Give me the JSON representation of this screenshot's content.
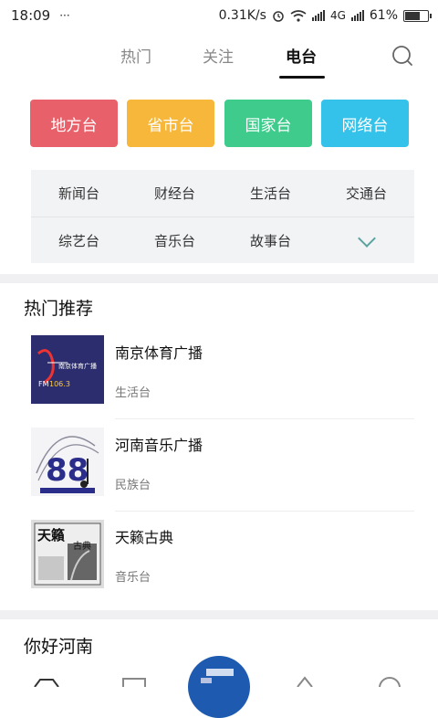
{
  "status": {
    "time": "18:09",
    "dots": "···",
    "speed": "0.31K/s",
    "network": "4G",
    "battery": "61%"
  },
  "tabs": [
    {
      "label": "热门"
    },
    {
      "label": "关注"
    },
    {
      "label": "电台"
    }
  ],
  "categories": [
    {
      "label": "地方台",
      "color": "#e8616a"
    },
    {
      "label": "省市台",
      "color": "#f7b73a"
    },
    {
      "label": "国家台",
      "color": "#3ecb8c"
    },
    {
      "label": "网络台",
      "color": "#35c2ea"
    }
  ],
  "subcategories": {
    "row1": [
      "新闻台",
      "财经台",
      "生活台",
      "交通台"
    ],
    "row2": [
      "综艺台",
      "音乐台",
      "故事台"
    ]
  },
  "hot": {
    "title": "热门推荐",
    "items": [
      {
        "name": "南京体育广播",
        "sub": "生活台"
      },
      {
        "name": "河南音乐广播",
        "sub": "民族台"
      },
      {
        "name": "天籁古典",
        "sub": "音乐台"
      }
    ]
  },
  "section2": {
    "title": "你好河南"
  },
  "thumbs": {
    "nj_fm": "FM",
    "nj_freq": "106.3",
    "hn_num": "88",
    "tl_text": "天籟",
    "tl_sub": "古典"
  },
  "colors": {
    "accent": "#111111"
  }
}
